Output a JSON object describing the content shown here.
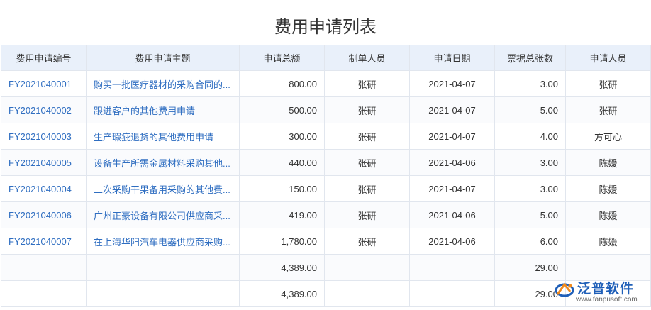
{
  "title": "费用申请列表",
  "columns": [
    "费用申请编号",
    "费用申请主题",
    "申请总额",
    "制单人员",
    "申请日期",
    "票据总张数",
    "申请人员"
  ],
  "rows": [
    {
      "id": "FY2021040001",
      "subject": "购买一批医疗器材的采购合同的...",
      "amount": "800.00",
      "creator": "张研",
      "date": "2021-04-07",
      "receipts": "3.00",
      "applicant": "张研"
    },
    {
      "id": "FY2021040002",
      "subject": "跟进客户的其他费用申请",
      "amount": "500.00",
      "creator": "张研",
      "date": "2021-04-07",
      "receipts": "5.00",
      "applicant": "张研"
    },
    {
      "id": "FY2021040003",
      "subject": "生产瑕疵退货的其他费用申请",
      "amount": "300.00",
      "creator": "张研",
      "date": "2021-04-07",
      "receipts": "4.00",
      "applicant": "方可心"
    },
    {
      "id": "FY2021040005",
      "subject": "设备生产所需金属材料采购其他...",
      "amount": "440.00",
      "creator": "张研",
      "date": "2021-04-06",
      "receipts": "3.00",
      "applicant": "陈媛"
    },
    {
      "id": "FY2021040004",
      "subject": "二次采购干果备用采购的其他费...",
      "amount": "150.00",
      "creator": "张研",
      "date": "2021-04-07",
      "receipts": "3.00",
      "applicant": "陈媛"
    },
    {
      "id": "FY2021040006",
      "subject": "广州正豪设备有限公司供应商采...",
      "amount": "419.00",
      "creator": "张研",
      "date": "2021-04-06",
      "receipts": "5.00",
      "applicant": "陈媛"
    },
    {
      "id": "FY2021040007",
      "subject": "在上海华阳汽车电器供应商采购...",
      "amount": "1,780.00",
      "creator": "张研",
      "date": "2021-04-06",
      "receipts": "6.00",
      "applicant": "陈媛"
    }
  ],
  "totals": [
    {
      "amount": "4,389.00",
      "receipts": "29.00"
    },
    {
      "amount": "4,389.00",
      "receipts": "29.00"
    }
  ],
  "logo": {
    "name": "泛普软件",
    "url": "www.fanpusoft.com",
    "icon": "fanpu-logo-icon"
  },
  "colors": {
    "header_bg": "#e9f0fa",
    "link": "#2f6ec1",
    "border": "#e1e6ee",
    "brand": "#1f5fb8",
    "brand_accent": "#f08a1c"
  }
}
